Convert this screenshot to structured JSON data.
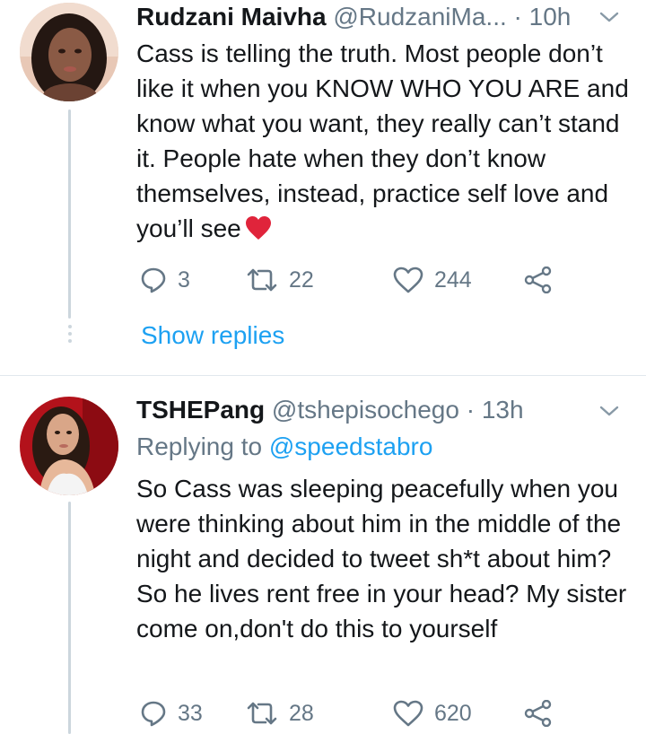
{
  "tweets": [
    {
      "name": "Rudzani Maivha",
      "handle": "@RudzaniMa...",
      "separator": "·",
      "time": "10h",
      "text": "Cass is telling the truth. Most people don’t like it when you KNOW WHO YOU ARE and know what you want, they really can’t stand it. People hate when they don’t know themselves, instead, practice self love and you’ll see",
      "emoji": "red-heart",
      "replies": "3",
      "retweets": "22",
      "likes": "244",
      "show_replies": "Show replies"
    },
    {
      "name": "TSHEPang",
      "handle": "@tshepisochego",
      "separator": "·",
      "time": "13h",
      "replying_prefix": "Replying to",
      "replying_to": "@speedstabro",
      "text": "So Cass was sleeping peacefully when you were thinking about him in the middle of the night and decided to tweet sh*t about him? So he lives rent free in your head? My sister come on,don't do this to yourself",
      "replies": "33",
      "retweets": "28",
      "likes": "620"
    }
  ],
  "colors": {
    "link": "#1da1f2",
    "secondary_text": "#657786",
    "primary_text": "#14171a",
    "divider": "#e1e8ed",
    "heart_emoji": "#e0243b"
  },
  "icons": [
    "reply-icon",
    "retweet-icon",
    "like-icon",
    "share-icon",
    "chevron-down-icon",
    "red-heart-emoji"
  ]
}
